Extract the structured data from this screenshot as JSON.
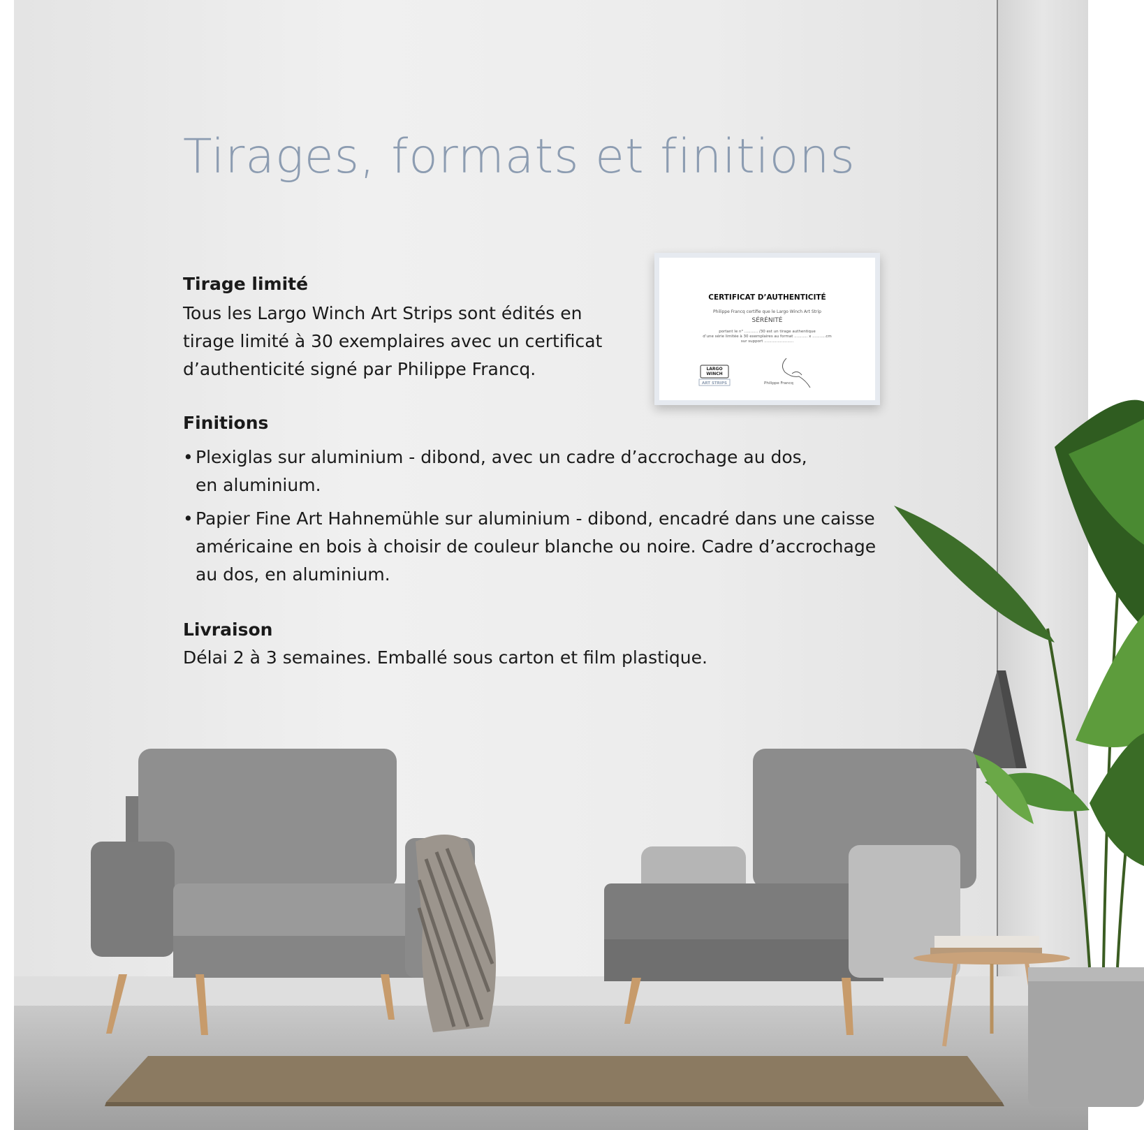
{
  "title": "Tirages, formats et finitions",
  "tirage": {
    "heading": "Tirage limité",
    "lines": [
      "Tous les Largo Winch Art Strips sont édités en",
      "tirage limité à 30 exemplaires avec un certificat",
      "d’authenticité signé par Philippe Francq."
    ]
  },
  "finitions": {
    "heading": "Finitions",
    "bullet_symbol": "•",
    "items": [
      {
        "lines": [
          "Plexiglas sur aluminium - dibond, avec un cadre d’accrochage au dos,",
          "en aluminium."
        ]
      },
      {
        "lines": [
          "Papier Fine Art Hahnemühle sur aluminium - dibond, encadré dans une caisse",
          "américaine en bois à choisir de couleur blanche ou noire. Cadre d’accrochage",
          "au dos, en aluminium."
        ]
      }
    ]
  },
  "livraison": {
    "heading": "Livraison",
    "text": "Délai 2 à 3 semaines. Emballé sous carton et film plastique."
  },
  "certificate": {
    "title": "CERTIFICAT D’AUTHENTICITÉ",
    "line1": "Philippe Francq certifie que le Largo Winch Art Strip",
    "artwork": "SÉRÉNITÉ",
    "line3": "portant le n° ........... /30 est un tirage authentique",
    "line4": "d’une série limitée à 30 exemplaires au format ........... x ...........cm",
    "line5": "sur support ........................",
    "logo_line1": "LARGO",
    "logo_line2": "WINCH",
    "logo_line3": "ART STRIPS",
    "signatory": "Philippe Francq"
  },
  "colors": {
    "title": "#8c9cb1",
    "text": "#1a1a1a",
    "wall": "#ebebeb",
    "sofa": "#8d8d8d",
    "leaf": "#3f7d2c"
  }
}
